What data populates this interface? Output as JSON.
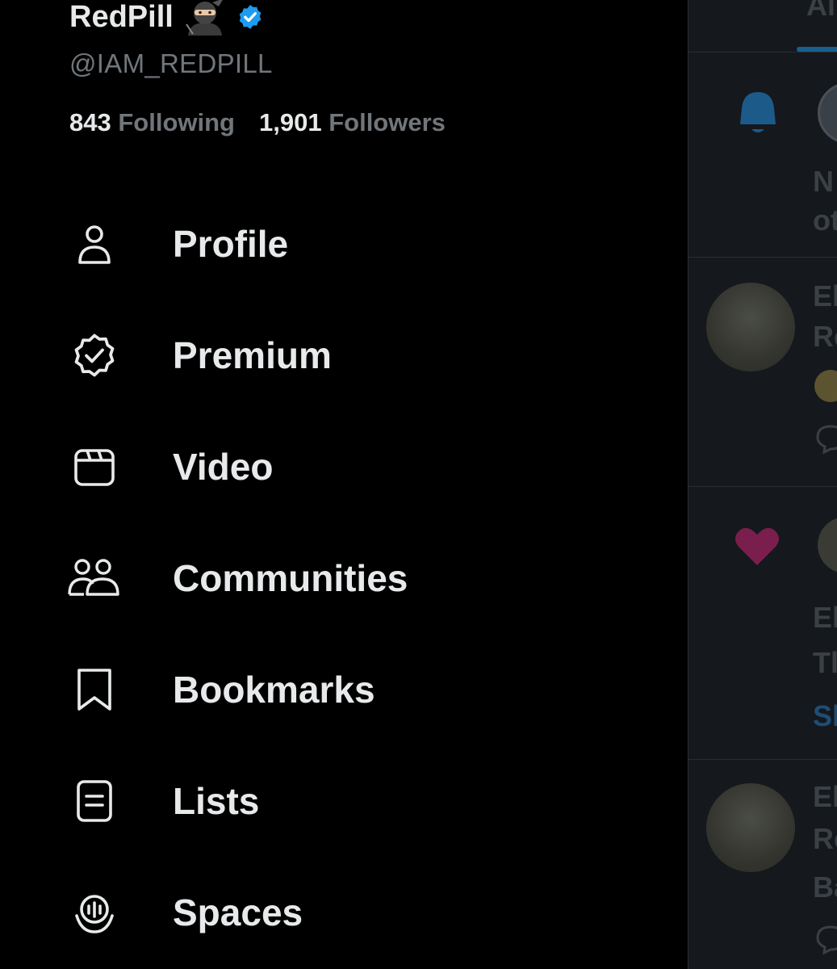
{
  "profile": {
    "name": "RedPill",
    "handle": "@IAM_REDPILL",
    "following_count": "843",
    "following_label": "Following",
    "followers_count": "1,901",
    "followers_label": "Followers"
  },
  "menu": [
    {
      "label": "Profile",
      "icon": "person-icon"
    },
    {
      "label": "Premium",
      "icon": "verified-badge-icon"
    },
    {
      "label": "Video",
      "icon": "video-icon"
    },
    {
      "label": "Communities",
      "icon": "communities-icon"
    },
    {
      "label": "Bookmarks",
      "icon": "bookmark-icon"
    },
    {
      "label": "Lists",
      "icon": "list-icon"
    },
    {
      "label": "Spaces",
      "icon": "spaces-icon"
    }
  ],
  "timeline": {
    "tab": "Al",
    "snippets": [
      "N",
      "ot",
      "El",
      "Re",
      "El",
      "Tl",
      "Sl",
      "El",
      "Re",
      "Ba"
    ]
  },
  "colors": {
    "background": "#000000",
    "text": "#e7e9ea",
    "secondary_text": "#71767b",
    "verified_blue": "#1d9bf0",
    "bell_blue": "#1c5a8a",
    "heart": "#7a1f4d"
  }
}
